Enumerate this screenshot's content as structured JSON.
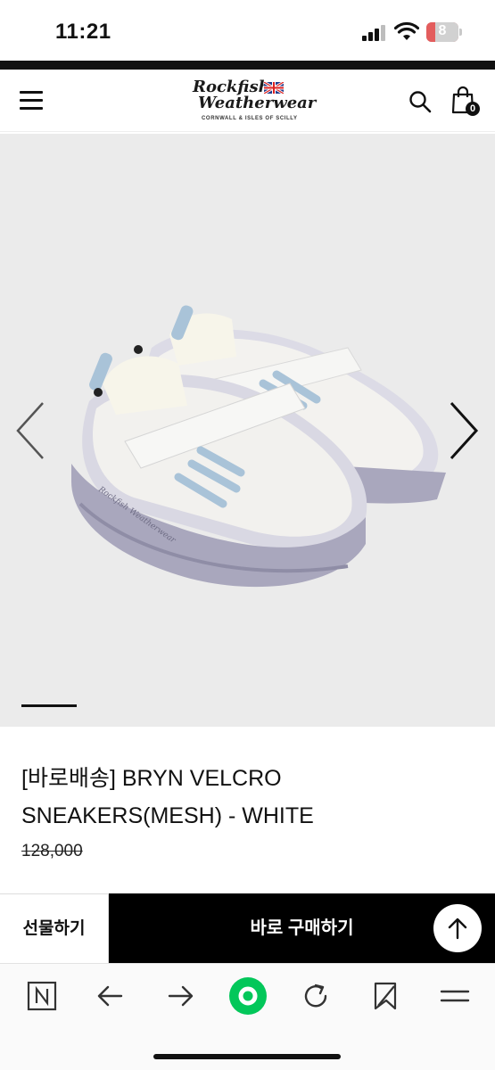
{
  "status_bar": {
    "time": "11:21",
    "battery_level": "8"
  },
  "header": {
    "logo_line1": "Rockfish",
    "logo_line2": "Weatherwear",
    "logo_subtitle": "CORNWALL & ISLES OF SCILLY",
    "menu_icon": "hamburger-icon",
    "search_icon": "search-icon",
    "cart_icon": "shopping-bag-icon",
    "cart_count": "0"
  },
  "gallery": {
    "prev_icon": "chevron-left-icon",
    "next_icon": "chevron-right-icon",
    "image_brand_text": "Rockfish Weatherwear",
    "colors": {
      "background": "#ebebeb",
      "upper": "#f2f1ee",
      "sole": "#a9a7bd",
      "strap_accent": "#a9c3d8"
    }
  },
  "product": {
    "title": "[바로배송] BRYN VELCRO SNEAKERS(MESH) - WHITE",
    "price": "128,000"
  },
  "actions": {
    "gift_label": "선물하기",
    "buy_label": "바로 구매하기",
    "scroll_top_icon": "arrow-up-icon"
  },
  "browser_bar": {
    "buttons": [
      "naver-n-icon",
      "back-arrow-icon",
      "forward-arrow-icon",
      "naver-green-icon",
      "reload-icon",
      "bookmark-icon",
      "menu-lines-icon"
    ],
    "accent": "#03c75a"
  }
}
